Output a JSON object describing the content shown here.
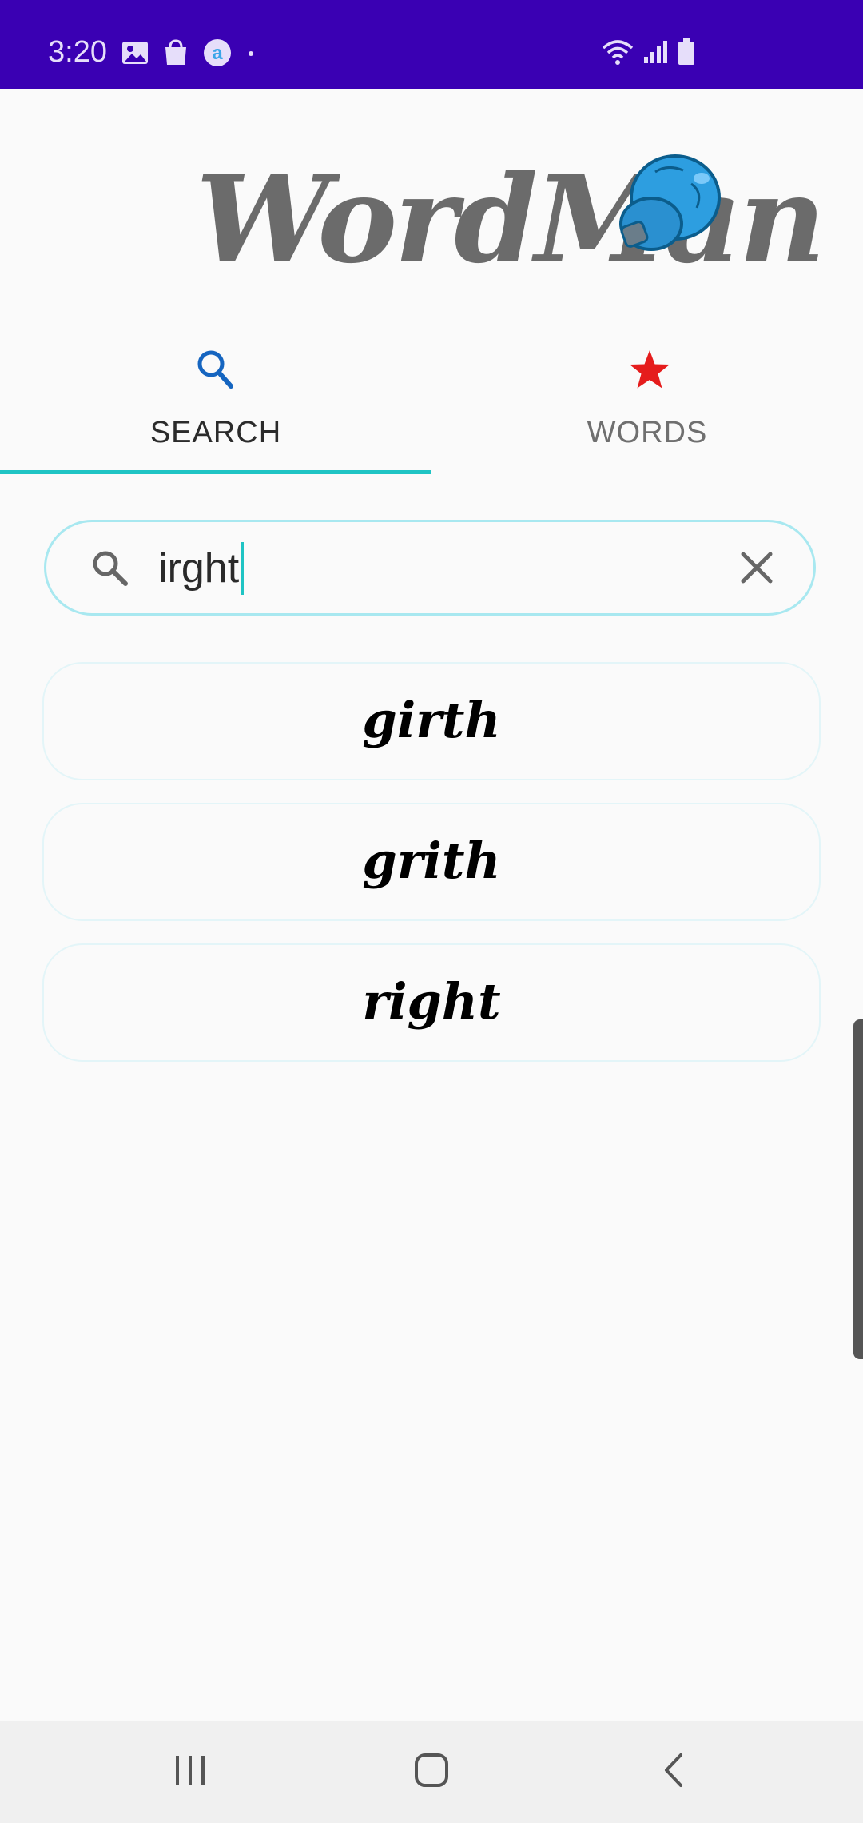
{
  "status_bar": {
    "time": "3:20",
    "background": "#3a00b3",
    "left_icons": [
      "image-icon",
      "shopping-bag-icon",
      "app-a-icon",
      "dot-icon"
    ],
    "right_icons": [
      "wifi-icon",
      "signal-icon",
      "battery-icon"
    ]
  },
  "app": {
    "logo_text": "WordMan",
    "logo_icon": "boxing-glove-icon"
  },
  "tabs": [
    {
      "label": "SEARCH",
      "icon": "search-icon",
      "selected": true,
      "accent": "#1565c0"
    },
    {
      "label": "WORDS",
      "icon": "star-icon",
      "selected": false,
      "accent": "#e51c1c"
    }
  ],
  "search": {
    "value": "irght",
    "placeholder": "",
    "search_icon": "search-icon",
    "clear_icon": "close-icon"
  },
  "results": [
    {
      "word": "girth"
    },
    {
      "word": "grith"
    },
    {
      "word": "right"
    }
  ],
  "nav_bar": {
    "buttons": [
      "recent-apps-icon",
      "home-icon",
      "back-icon"
    ]
  },
  "colors": {
    "accent": "#1fc4c4",
    "search_border": "#a8e8f0",
    "result_border": "#e3f5f8"
  }
}
